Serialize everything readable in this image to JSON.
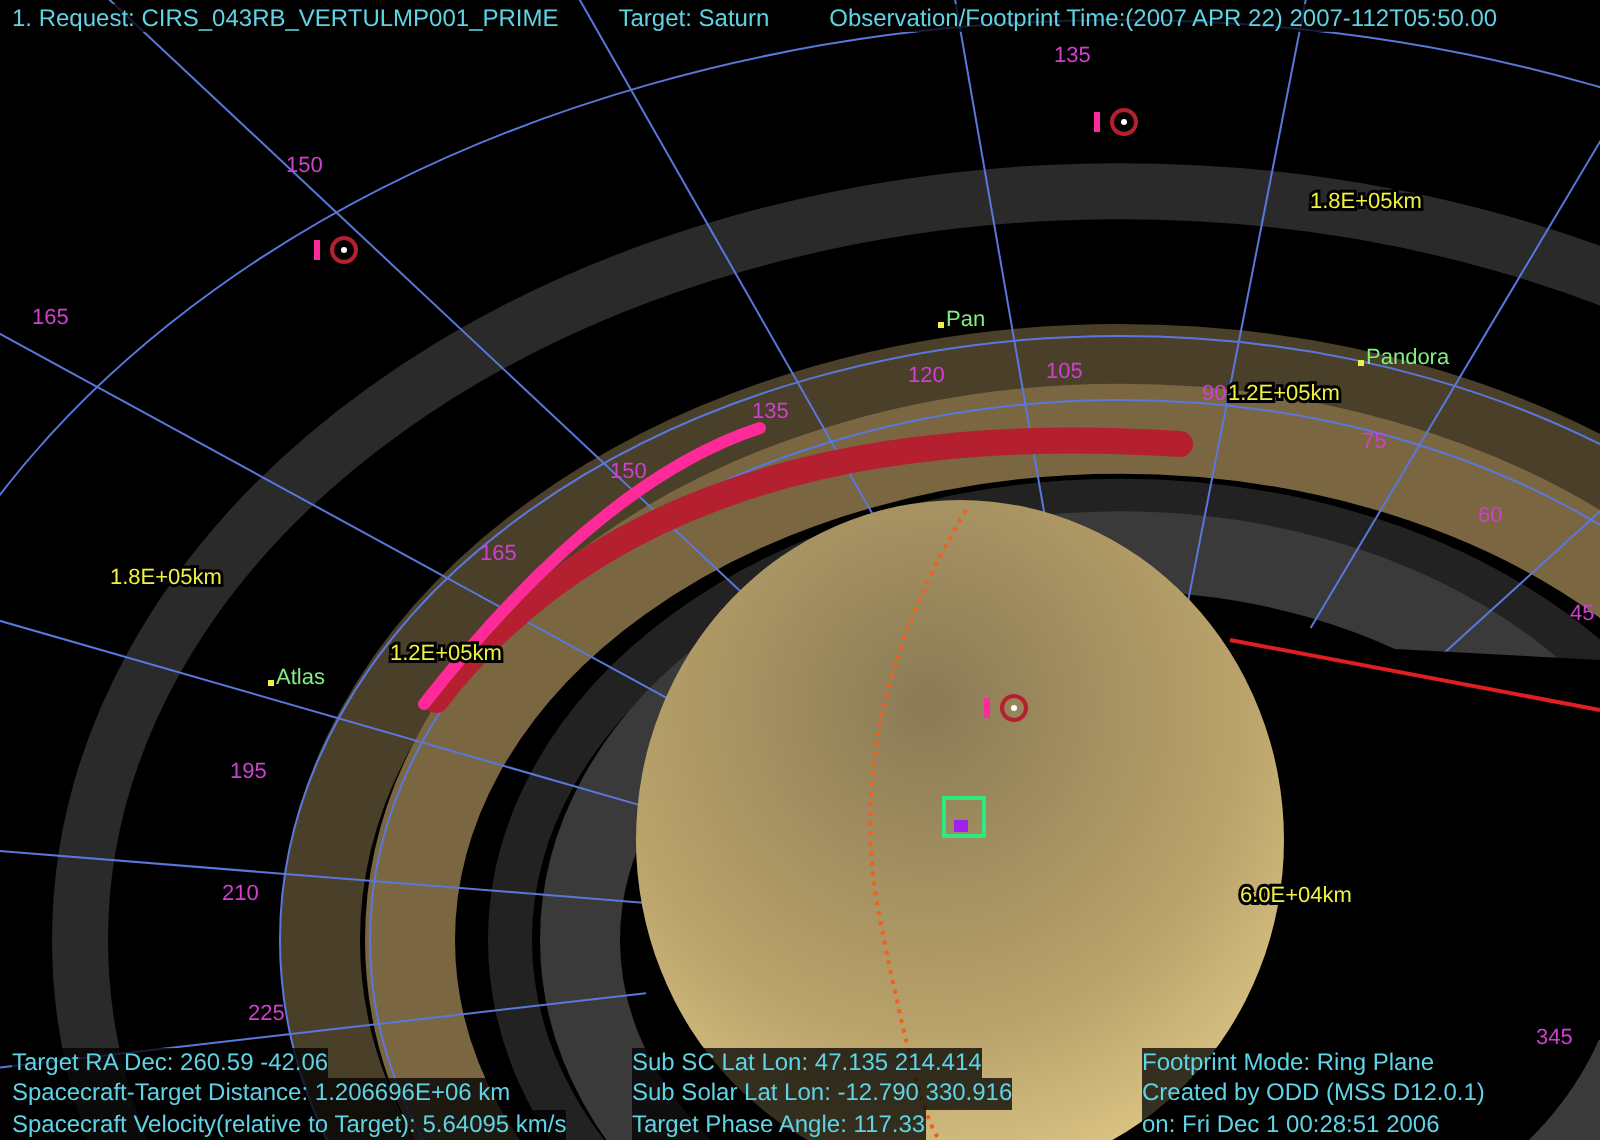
{
  "header": {
    "request": "1. Request: CIRS_043RB_VERTULMP001_PRIME",
    "target": "Target: Saturn",
    "time": "Observation/Footprint Time:(2007 APR 22) 2007-112T05:50.00"
  },
  "scene": {
    "longitude_labels": [
      "135",
      "150",
      "165",
      "135",
      "150",
      "165",
      "120",
      "105",
      "90",
      "75",
      "60",
      "45",
      "195",
      "210",
      "225",
      "345"
    ],
    "distance_labels": [
      "1.8E+05km",
      "1.8E+05km",
      "1.2E+05km",
      "1.2E+05km",
      "6.0E+04km"
    ],
    "moons": [
      "Pan",
      "Pandora",
      "Atlas"
    ]
  },
  "footer": {
    "left": [
      "Target RA Dec: 260.59  -42.06",
      "Spacecraft-Target Distance: 1.206696E+06 km",
      "Spacecraft Velocity(relative to Target): 5.64095 km/s"
    ],
    "middle": [
      "Sub SC Lat Lon: 47.135  214.414",
      "Sub Solar Lat Lon: -12.790  330.916",
      "Target Phase Angle: 117.33"
    ],
    "right": [
      "Footprint Mode: Ring Plane",
      "Created by ODD (MSS D12.0.1)",
      "on: Fri Dec  1 00:28:51 2006"
    ]
  }
}
